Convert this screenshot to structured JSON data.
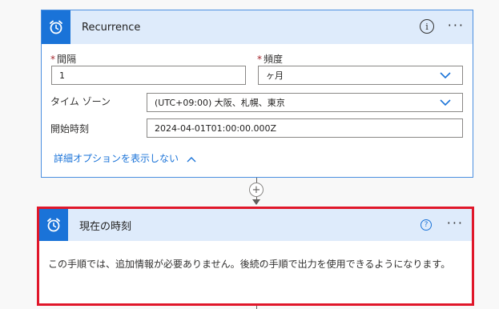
{
  "recurrence": {
    "title": "Recurrence",
    "interval": {
      "label": "間隔",
      "required_mark": "*",
      "value": "1"
    },
    "frequency": {
      "label": "頻度",
      "required_mark": "*",
      "value": "ヶ月"
    },
    "timezone": {
      "label": "タイム ゾーン",
      "value": "(UTC+09:00) 大阪、札幌、東京"
    },
    "start_time": {
      "label": "開始時刻",
      "value": "2024-04-01T01:00:00.000Z"
    },
    "advanced_toggle": "詳細オプションを表示しない"
  },
  "connector": {
    "add_label": "+"
  },
  "current_time": {
    "title": "現在の時刻",
    "message": "この手順では、追加情報が必要ありません。後続の手順で出力を使用できるようになります。"
  },
  "header_buttons": {
    "info": "i",
    "help": "?",
    "more": "···"
  },
  "colors": {
    "accent": "#1a73d8",
    "header_bg": "#deebfb",
    "selected_border": "#e0172a"
  }
}
